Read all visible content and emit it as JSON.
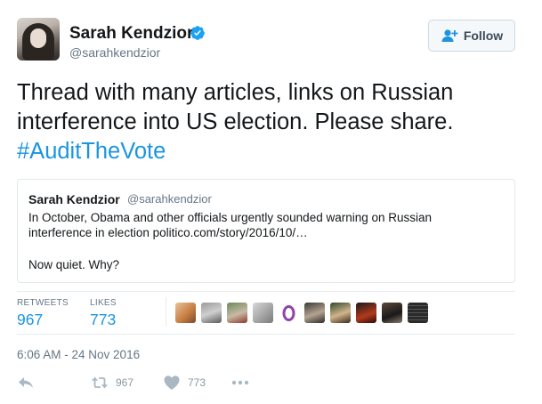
{
  "author": {
    "name": "Sarah Kendzior",
    "handle": "@sarahkendzior",
    "verified": true
  },
  "follow_button": {
    "label": "Follow"
  },
  "tweet": {
    "text_line1": "Thread with many articles, links on Russian",
    "text_line2": "interference into US election. Please share.",
    "hashtag": "#AuditTheVote"
  },
  "quoted_tweet": {
    "name": "Sarah Kendzior",
    "handle": "@sarahkendzior",
    "line1": "In October, Obama and other officials urgently sounded warning on Russian",
    "line2": "interference in election politico.com/story/2016/10/…",
    "line3": "Now quiet. Why?"
  },
  "stats": {
    "retweets_label": "RETWEETS",
    "retweets_value": "967",
    "likes_label": "LIKES",
    "likes_value": "773"
  },
  "timestamp": "6:06 AM - 24 Nov 2016",
  "actions": {
    "retweet_count": "967",
    "like_count": "773"
  },
  "colors": {
    "accent": "#1b95e0",
    "secondary_text": "#657786",
    "verified": "#1da1f2"
  }
}
